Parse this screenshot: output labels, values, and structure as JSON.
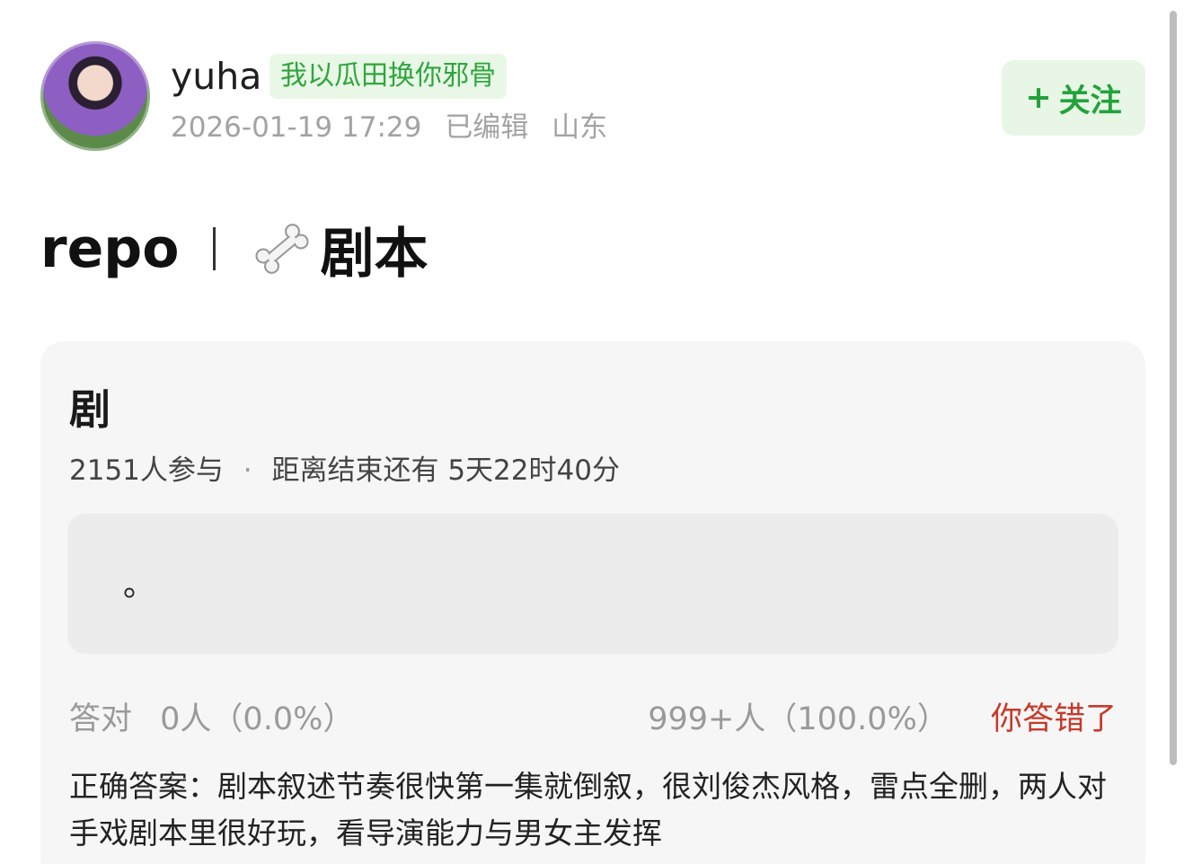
{
  "post": {
    "username": "yuha",
    "badge": "我以瓜田换你邪骨",
    "date": "2026-01-19 17:29",
    "edited": "已编辑",
    "location": "山东",
    "follow_label": "关注",
    "follow_plus": "+",
    "title_prefix": "repo",
    "title_text": "剧本"
  },
  "quiz": {
    "title": "剧",
    "participants": "2151人参与",
    "separator": "·",
    "remaining": "距离结束还有 5天22时40分",
    "option_text": "。",
    "correct_label": "答对",
    "correct_value": "0人（0.0%）",
    "other_value": "999+人（100.0%）",
    "wrong_label": "你答错了",
    "answer_text": "正确答案：剧本叙述节奏很快第一集就倒叙，很刘俊杰风格，雷点全删，两人对手戏剧本里很好玩，看导演能力与男女主发挥"
  },
  "colors": {
    "accent_green": "#23a23a",
    "badge_green": "#2fa63d",
    "wrong_red": "#c8392b"
  },
  "icons": {
    "title": "bone-icon"
  }
}
